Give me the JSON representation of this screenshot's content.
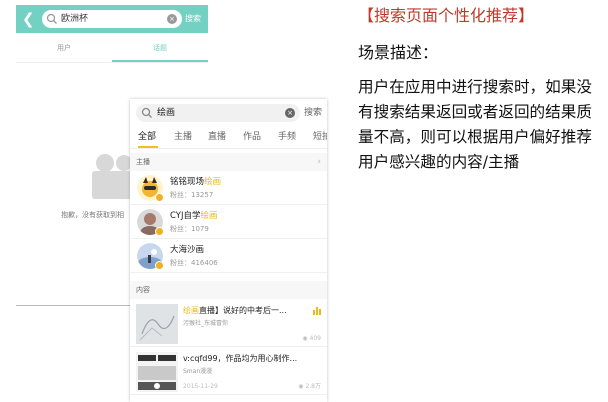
{
  "screen_a": {
    "search": {
      "back_icon": "chevron-left-icon",
      "query": "欧洲杯",
      "button_label": "搜索"
    },
    "tabs": [
      {
        "label": "用户"
      },
      {
        "label": "话题"
      }
    ],
    "empty_state": {
      "icon": "video-camera-icon",
      "message": "抱歉，没有获取到相"
    },
    "accent_color": "#73d1c4"
  },
  "screen_b": {
    "search": {
      "query": "绘画",
      "button_label": "搜索"
    },
    "tabs": [
      {
        "label": "全部"
      },
      {
        "label": "主播"
      },
      {
        "label": "直播"
      },
      {
        "label": "作品"
      },
      {
        "label": "手频"
      },
      {
        "label": "短拍"
      }
    ],
    "anchors_section": {
      "label": "主播"
    },
    "users": [
      {
        "name": "铭铭现场",
        "highlight": "绘画",
        "fans": "粉丝：13257"
      },
      {
        "name": "CYJ自学",
        "highlight": "绘画",
        "fans": "粉丝：1079"
      },
      {
        "name": "大海沙画",
        "highlight": "",
        "fans": "粉丝：416406"
      }
    ],
    "content_section": {
      "label": "内容"
    },
    "videos": [
      {
        "highlight": "绘画",
        "title": "直播】说好的中考后一...",
        "author": "污猴社_东城冒你",
        "date": "",
        "count": "409"
      },
      {
        "highlight": "",
        "title": "v:cqfd99，作品均为用心制作...",
        "author": "Sman漫漫",
        "date": "2015-11-29",
        "count": "2.8万"
      }
    ],
    "highlight_color": "#e8b820"
  },
  "panel": {
    "title": "【搜索页面个性化推荐】",
    "label": "场景描述：",
    "body": "用户在应用中进行搜索时，如果没有搜索结果返回或者返回的结果质量不高，则可以根据用户偏好推荐用户感兴趣的内容/主播",
    "title_color": "#c0392b"
  }
}
